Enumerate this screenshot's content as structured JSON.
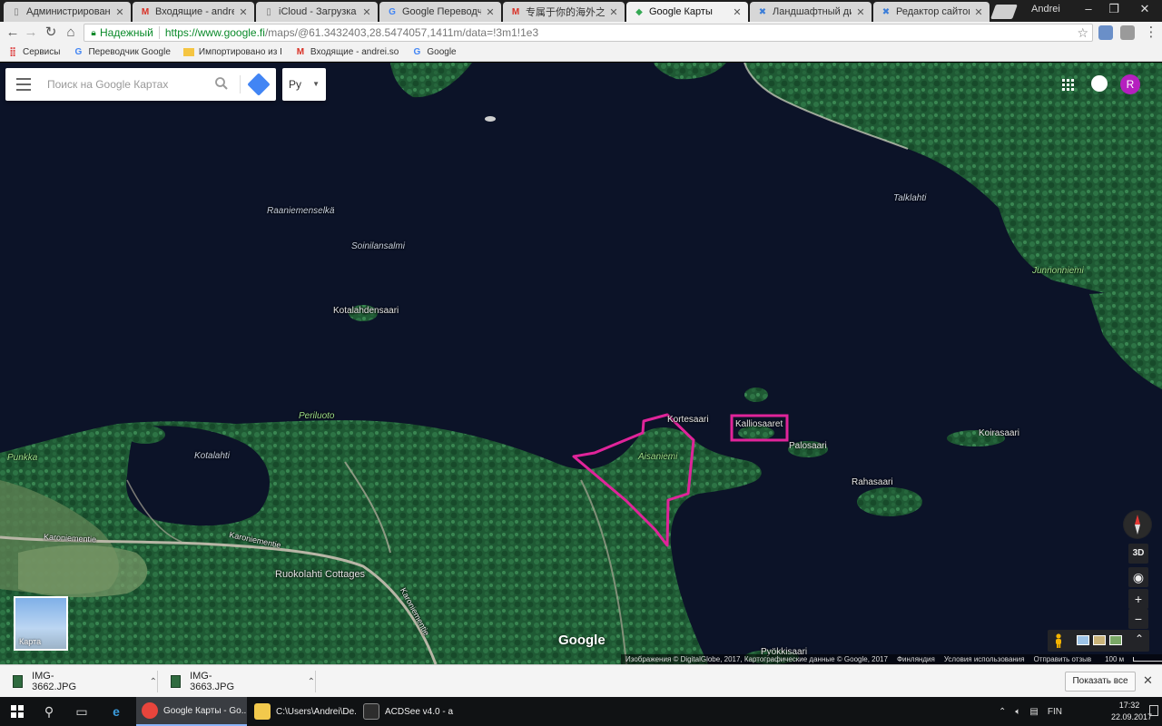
{
  "browser": {
    "tabs": [
      {
        "label": "Администрирование",
        "icon": "page-icon",
        "color": "#777777"
      },
      {
        "label": "Входящие - andrei.so",
        "icon": "gmail-icon",
        "color": "#d93025"
      },
      {
        "label": "iCloud - Загрузка «D",
        "icon": "page-icon",
        "color": "#777777"
      },
      {
        "label": "Google Переводчик",
        "icon": "translate-icon",
        "color": "#4285f4"
      },
      {
        "label": "专属于你的海外之家",
        "icon": "gmail-icon",
        "color": "#d93025"
      },
      {
        "label": "Google Карты",
        "icon": "maps-icon",
        "color": "#34a853"
      },
      {
        "label": "Ландшафтный дизай",
        "icon": "wix-icon",
        "color": "#3b7dd8"
      },
      {
        "label": "Редактор сайтов Wix",
        "icon": "wix-icon",
        "color": "#3b7dd8"
      }
    ],
    "user": "Andrei",
    "secure_label": "Надежный",
    "url_host": "https://www.google.fi",
    "url_rest": "/maps/@61.3432403,28.5474057,1411m/data=!3m1!1e3",
    "bookmarks": [
      {
        "label": "Сервисы",
        "icon": "apps-grid-icon"
      },
      {
        "label": "Переводчик Google",
        "icon": "translate-icon"
      },
      {
        "label": "Импортировано из I",
        "icon": "folder-icon"
      },
      {
        "label": "Входящие - andrei.so",
        "icon": "gmail-icon"
      },
      {
        "label": "Google",
        "icon": "google-icon"
      }
    ]
  },
  "maps": {
    "search_placeholder": "Поиск на Google Картах",
    "language": "Ру",
    "avatar_letter": "R",
    "labels": [
      {
        "text": "Raaniemenselkä",
        "style": "it"
      },
      {
        "text": "Soinilansalmi",
        "style": "it"
      },
      {
        "text": "Kotalahdensaari",
        "style": "plain"
      },
      {
        "text": "Periluoto",
        "style": "green"
      },
      {
        "text": "Punkka",
        "style": "green"
      },
      {
        "text": "Kotalahti",
        "style": "it"
      },
      {
        "text": "Kortesaari",
        "style": "plain"
      },
      {
        "text": "Aisaniemi",
        "style": "green"
      },
      {
        "text": "Kalliosaaret",
        "style": "plain"
      },
      {
        "text": "Palosaari",
        "style": "plain"
      },
      {
        "text": "Koirasaari",
        "style": "plain"
      },
      {
        "text": "Rahasaari",
        "style": "plain"
      },
      {
        "text": "Talklahti",
        "style": "it"
      },
      {
        "text": "Junnonniemi",
        "style": "green"
      },
      {
        "text": "Ruokolahti Cottages",
        "style": "plain"
      },
      {
        "text": "Karoniementie",
        "style": "road"
      },
      {
        "text": "Karoniementie",
        "style": "road"
      },
      {
        "text": "Karoniementie",
        "style": "road"
      },
      {
        "text": "Pyökkisaari",
        "style": "plain"
      }
    ],
    "control_3d": "3D",
    "zoom_in": "+",
    "zoom_out": "−",
    "minimap_label": "Карта",
    "logo": "Google",
    "attribution": {
      "imagery": "Изображения © DigitalGlobe, 2017, Картографические данные © Google, 2017",
      "country": "Финляндия",
      "terms": "Условия использования",
      "feedback": "Отправить отзыв",
      "scale": "100 м"
    },
    "annotation_color": "#e0249a"
  },
  "downloads": {
    "items": [
      {
        "name": "IMG-3662.JPG"
      },
      {
        "name": "IMG-3663.JPG"
      }
    ],
    "show_all": "Показать все"
  },
  "taskbar": {
    "apps": [
      {
        "label": "Google Карты - Go...",
        "color": "#e8453c",
        "active": true
      },
      {
        "label": "C:\\Users\\Andrei\\De...",
        "color": "#f2c94c",
        "active": false
      },
      {
        "label": "ACDSee v4.0 - a",
        "color": "#2d2d2d",
        "active": false
      }
    ],
    "lang": "FIN",
    "time": "17:32",
    "date": "22.09.2017"
  }
}
